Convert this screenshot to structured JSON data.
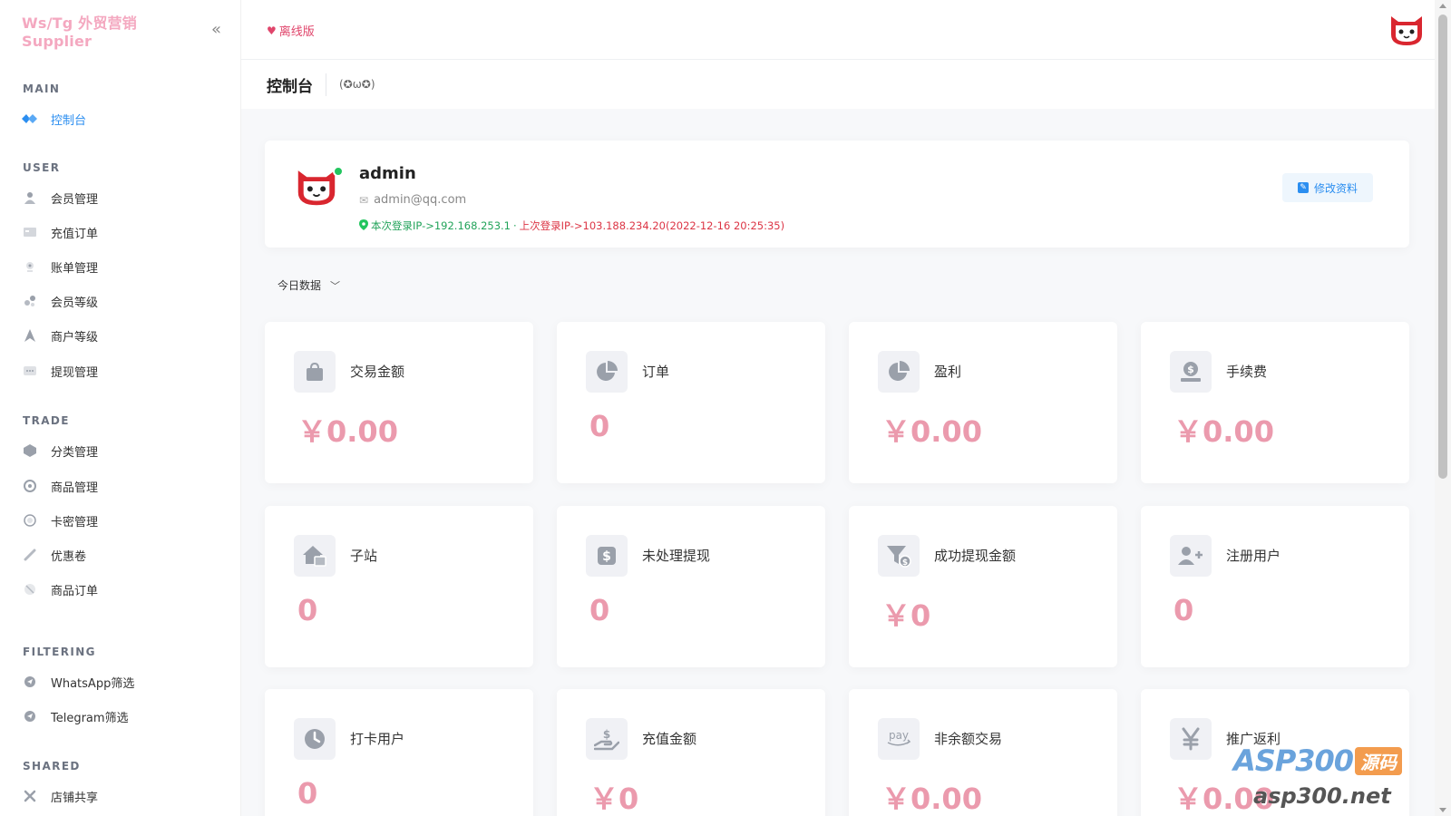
{
  "brand": {
    "name": "Ws/Tg 外贸营销 Supplier"
  },
  "sidebar": {
    "sections": [
      {
        "title": "MAIN",
        "items": [
          {
            "label": "控制台",
            "icon": "dashboard-icon",
            "active": true
          }
        ]
      },
      {
        "title": "USER",
        "items": [
          {
            "label": "会员管理",
            "icon": "user-icon"
          },
          {
            "label": "充值订单",
            "icon": "recharge-icon"
          },
          {
            "label": "账单管理",
            "icon": "bill-icon"
          },
          {
            "label": "会员等级",
            "icon": "level-icon"
          },
          {
            "label": "商户等级",
            "icon": "merchant-icon"
          },
          {
            "label": "提现管理",
            "icon": "withdraw-icon"
          }
        ]
      },
      {
        "title": "TRADE",
        "items": [
          {
            "label": "分类管理",
            "icon": "category-icon"
          },
          {
            "label": "商品管理",
            "icon": "product-icon"
          },
          {
            "label": "卡密管理",
            "icon": "card-icon"
          },
          {
            "label": "优惠卷",
            "icon": "coupon-icon"
          },
          {
            "label": "商品订单",
            "icon": "order-icon"
          }
        ]
      },
      {
        "title": "FILTERING",
        "items": [
          {
            "label": "WhatsApp筛选",
            "icon": "whatsapp-icon"
          },
          {
            "label": "Telegram筛选",
            "icon": "telegram-icon"
          }
        ]
      },
      {
        "title": "SHARED",
        "items": [
          {
            "label": "店铺共享",
            "icon": "share-icon"
          }
        ]
      }
    ]
  },
  "header": {
    "offline_label": "离线版"
  },
  "titlebar": {
    "title": "控制台",
    "emote": "(✪ω✪)"
  },
  "profile": {
    "name": "admin",
    "email": "admin@qq.com",
    "current_login": "本次登录IP->192.168.253.1",
    "separator": "·",
    "last_login": "上次登录IP->103.188.234.20(2022-12-16 20:25:35)",
    "edit_label": "修改资料"
  },
  "range": {
    "label": "今日数据"
  },
  "stats": [
    {
      "label": "交易金额",
      "value": "￥0.00",
      "icon": "bag-icon"
    },
    {
      "label": "订单",
      "value": "0",
      "icon": "pie-chart-icon"
    },
    {
      "label": "盈利",
      "value": "￥0.00",
      "icon": "pie-chart-icon"
    },
    {
      "label": "手续费",
      "value": "￥0.00",
      "icon": "money-hand-icon"
    },
    {
      "label": "子站",
      "value": "0",
      "icon": "home-icon"
    },
    {
      "label": "未处理提现",
      "value": "0",
      "icon": "dollar-icon"
    },
    {
      "label": "成功提现金额",
      "value": "￥0",
      "icon": "filter-dollar-icon"
    },
    {
      "label": "注册用户",
      "value": "0",
      "icon": "user-plus-icon"
    },
    {
      "label": "打卡用户",
      "value": "0",
      "icon": "clock-icon"
    },
    {
      "label": "充值金额",
      "value": "￥0",
      "icon": "hand-dollar-icon"
    },
    {
      "label": "非余额交易",
      "value": "￥0.00",
      "icon": "pay-icon"
    },
    {
      "label": "推广返利",
      "value": "￥0.00",
      "icon": "yen-icon"
    }
  ],
  "watermark": {
    "brand": "ASP300",
    "badge": "源码",
    "url": "asp300.net"
  },
  "colors": {
    "brand_pink": "#f4a8c0",
    "accent_blue": "#2b8ef0",
    "value_pink": "#eb9aad",
    "online_green": "#22c55e",
    "error_red": "#dc3545"
  }
}
